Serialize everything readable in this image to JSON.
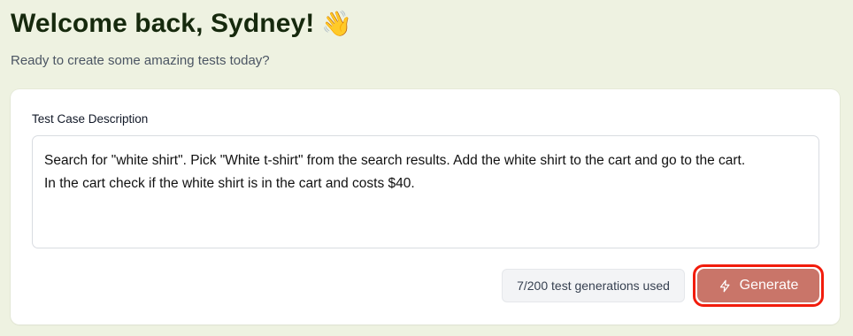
{
  "header": {
    "title": "Welcome back, Sydney!",
    "emoji": "👋",
    "subtitle": "Ready to create some amazing tests today?"
  },
  "form": {
    "label": "Test Case Description",
    "description_value": "Search for \"white shirt\". Pick \"White t-shirt\" from the search results. Add the white shirt to the cart and go to the cart.\nIn the cart check if the white shirt is in the cart and costs $40."
  },
  "usage": {
    "text": "7/200 test generations used",
    "used": 7,
    "limit": 200
  },
  "actions": {
    "generate_label": "Generate",
    "generate_icon": "lightning-bolt-icon"
  },
  "colors": {
    "background": "#eef2e1",
    "title": "#16290d",
    "generate_button": "#c97569",
    "highlight_outline": "#f21c0c"
  }
}
